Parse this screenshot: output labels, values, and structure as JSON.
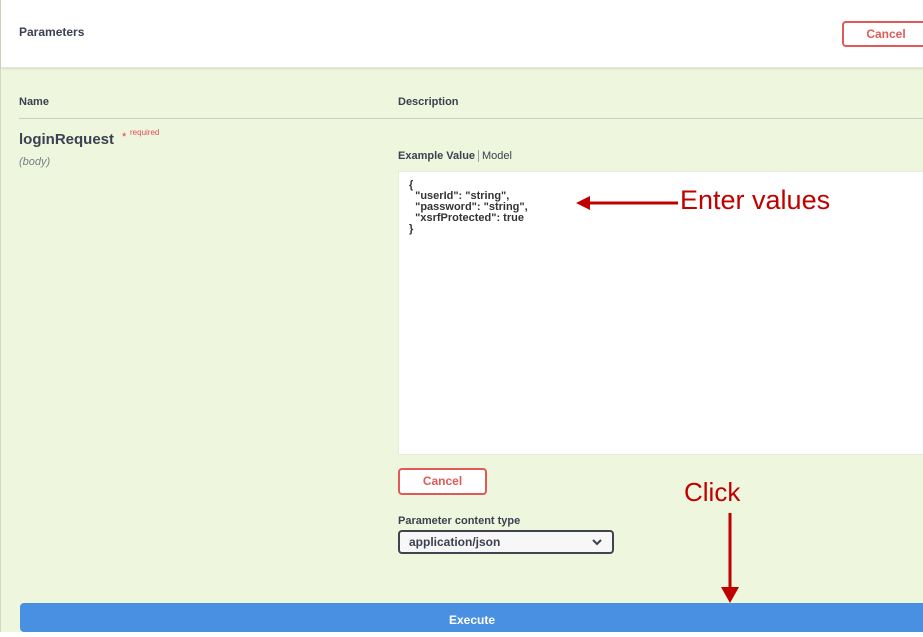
{
  "header": {
    "title": "Parameters",
    "cancel_label": "Cancel"
  },
  "table": {
    "name_header": "Name",
    "description_header": "Description"
  },
  "parameter": {
    "name": "loginRequest",
    "required_star": "*",
    "required_text": "required",
    "location": "(body)"
  },
  "body_tabs": {
    "example_value": "Example Value",
    "model": "Model"
  },
  "request_body": "{\n  \"userId\": \"string\",\n  \"password\": \"string\",\n  \"xsrfProtected\": true\n}",
  "body_cancel_label": "Cancel",
  "content_type": {
    "label": "Parameter content type",
    "selected": "application/json"
  },
  "execute_label": "Execute",
  "annotations": {
    "enter_values": "Enter values",
    "click": "Click",
    "color": "#c00000"
  },
  "colors": {
    "panel_background": "#eef6dd",
    "cancel_accent": "#e05a5a",
    "execute_button": "#4a90e2"
  },
  "icons": {
    "select_chevron": "chevron-down-icon",
    "left_arrow": "arrow-left-icon",
    "down_arrow": "arrow-down-icon"
  }
}
